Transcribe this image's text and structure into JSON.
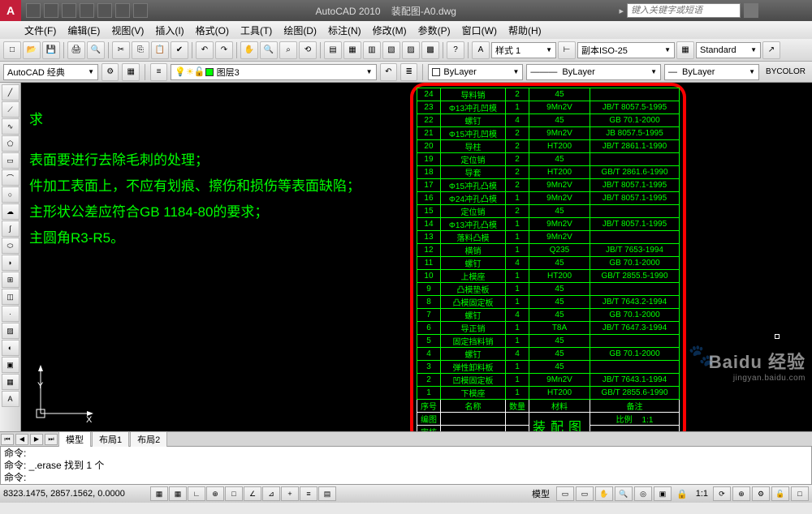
{
  "title": {
    "app": "AutoCAD 2010",
    "file": "装配图-A0.dwg"
  },
  "search_placeholder": "键入关键字或短语",
  "menu": [
    "文件(F)",
    "编辑(E)",
    "视图(V)",
    "插入(I)",
    "格式(O)",
    "工具(T)",
    "绘图(D)",
    "标注(N)",
    "修改(M)",
    "参数(P)",
    "窗口(W)",
    "帮助(H)"
  ],
  "workspace": "AutoCAD 经典",
  "layer_combo": "图层3",
  "style_label": "样式 1",
  "dim_style": "副本ISO-25",
  "text_style": "Standard",
  "prop_color": "ByLayer",
  "prop_ltype": "ByLayer",
  "prop_lweight": "ByLayer",
  "prop_plot": "BYCOLOR",
  "canvas_lines": [
    "求",
    "表面要进行去除毛刺的处理；",
    "件加工表面上，不应有划痕、擦伤和损伤等表面缺陷；",
    "主形状公差应符合GB 1184-80的要求；",
    "主圆角R3-R5。"
  ],
  "ucs": {
    "x": "X",
    "y": "Y"
  },
  "bom_rows": [
    [
      "24",
      "导料销",
      "2",
      "45",
      ""
    ],
    [
      "23",
      "Φ13冲孔凹模",
      "1",
      "9Mn2V",
      "JB/T 8057.5-1995"
    ],
    [
      "22",
      "螺钉",
      "4",
      "45",
      "GB 70.1-2000"
    ],
    [
      "21",
      "Φ15冲孔凹模",
      "2",
      "9Mn2V",
      "JB 8057.5-1995"
    ],
    [
      "20",
      "导柱",
      "2",
      "HT200",
      "JB/T 2861.1-1990"
    ],
    [
      "19",
      "定位销",
      "2",
      "45",
      ""
    ],
    [
      "18",
      "导套",
      "2",
      "HT200",
      "GB/T 2861.6-1990"
    ],
    [
      "17",
      "Φ15冲孔凸模",
      "2",
      "9Mn2V",
      "JB/T 8057.1-1995"
    ],
    [
      "16",
      "Φ24冲孔凸模",
      "1",
      "9Mn2V",
      "JB/T 8057.1-1995"
    ],
    [
      "15",
      "定位销",
      "2",
      "45",
      ""
    ],
    [
      "14",
      "Φ13冲孔凸模",
      "1",
      "9Mn2V",
      "JB/T 8057.1-1995"
    ],
    [
      "13",
      "落料凸模",
      "1",
      "9Mn2V",
      ""
    ],
    [
      "12",
      "横销",
      "1",
      "Q235",
      "JB/T 7653-1994"
    ],
    [
      "11",
      "螺钉",
      "4",
      "45",
      "GB 70.1-2000"
    ],
    [
      "10",
      "上模座",
      "1",
      "HT200",
      "GB/T 2855.5-1990"
    ],
    [
      "9",
      "凸模垫板",
      "1",
      "45",
      ""
    ],
    [
      "8",
      "凸模固定板",
      "1",
      "45",
      "JB/T 7643.2-1994"
    ],
    [
      "7",
      "螺钉",
      "4",
      "45",
      "GB 70.1-2000"
    ],
    [
      "6",
      "导正销",
      "1",
      "T8A",
      "JB/T 7647.3-1994"
    ],
    [
      "5",
      "固定挡料销",
      "1",
      "45",
      ""
    ],
    [
      "4",
      "螺钉",
      "4",
      "45",
      "GB 70.1-2000"
    ],
    [
      "3",
      "弹性卸料板",
      "1",
      "45",
      ""
    ],
    [
      "2",
      "凹模固定板",
      "1",
      "9Mn2V",
      "JB/T 7643.1-1994"
    ],
    [
      "1",
      "下模座",
      "1",
      "HT200",
      "GB/T 2855.6-1990"
    ]
  ],
  "bom_header": [
    "序号",
    "名称",
    "数量",
    "材料",
    "备注"
  ],
  "bom_footer": {
    "row1_l": "编图",
    "row2_l": "审核",
    "title": "装配图",
    "scale_l": "比例",
    "scale_v": "1:1"
  },
  "layout_tabs": {
    "model": "模型",
    "l1": "布局1",
    "l2": "布局2"
  },
  "cmd": {
    "line1": "命令:",
    "line2": "命令: _.erase 找到 1 个",
    "line3": "命令:"
  },
  "status": {
    "coords": "8323.1475, 2857.1562, 0.0000",
    "model": "模型",
    "scale": "1:1"
  },
  "watermark": {
    "main": "Baidu 经验",
    "sub": "jingyan.baidu.com"
  }
}
